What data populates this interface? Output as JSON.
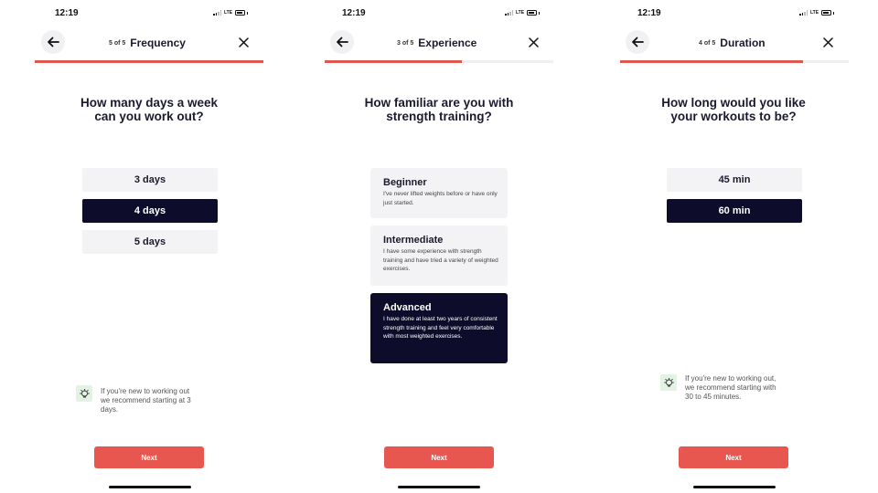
{
  "screens": [
    {
      "status_time": "12:19",
      "network": "LTE",
      "step": "5 of 5",
      "title": "Frequency",
      "progress": 1.0,
      "question": "How many days a week\ncan you work out?",
      "options": [
        {
          "label": "3 days",
          "selected": false
        },
        {
          "label": "4 days",
          "selected": true
        },
        {
          "label": "5 days",
          "selected": false
        }
      ],
      "tip": "If you're new to working out\nwe recommend starting at 3\ndays.",
      "next_label": "Next"
    },
    {
      "status_time": "12:19",
      "network": "LTE",
      "step": "3 of 5",
      "title": "Experience",
      "progress": 0.6,
      "question": "How familiar are you with\nstrength training?",
      "options": [
        {
          "label": "Beginner",
          "description": "I've never lifted weights before or have only just started.",
          "selected": false
        },
        {
          "label": "Intermediate",
          "description": "I have some experience with strength training and have tried a variety of weighted exercises.",
          "selected": false
        },
        {
          "label": "Advanced",
          "description": "I have done at least two years of consistent strength training and feel very comfortable with most weighted exercises.",
          "selected": true
        }
      ],
      "next_label": "Next"
    },
    {
      "status_time": "12:19",
      "network": "LTE",
      "step": "4 of 5",
      "title": "Duration",
      "progress": 0.8,
      "question": "How long would you like\nyour workouts to be?",
      "options": [
        {
          "label": "45 min",
          "selected": false
        },
        {
          "label": "60 min",
          "selected": true
        }
      ],
      "tip": "If you're new to working out,\nwe recommend starting with\n30 to 45 minutes.",
      "next_label": "Next"
    }
  ],
  "colors": {
    "accent": "#e8574f",
    "selected_bg": "#0d0c2a",
    "option_bg": "#f3f3f6",
    "tip_icon_bg": "#e3f3e3"
  },
  "icons": {
    "back": "arrow-left-icon",
    "close": "close-icon",
    "tip": "lightbulb-icon"
  }
}
